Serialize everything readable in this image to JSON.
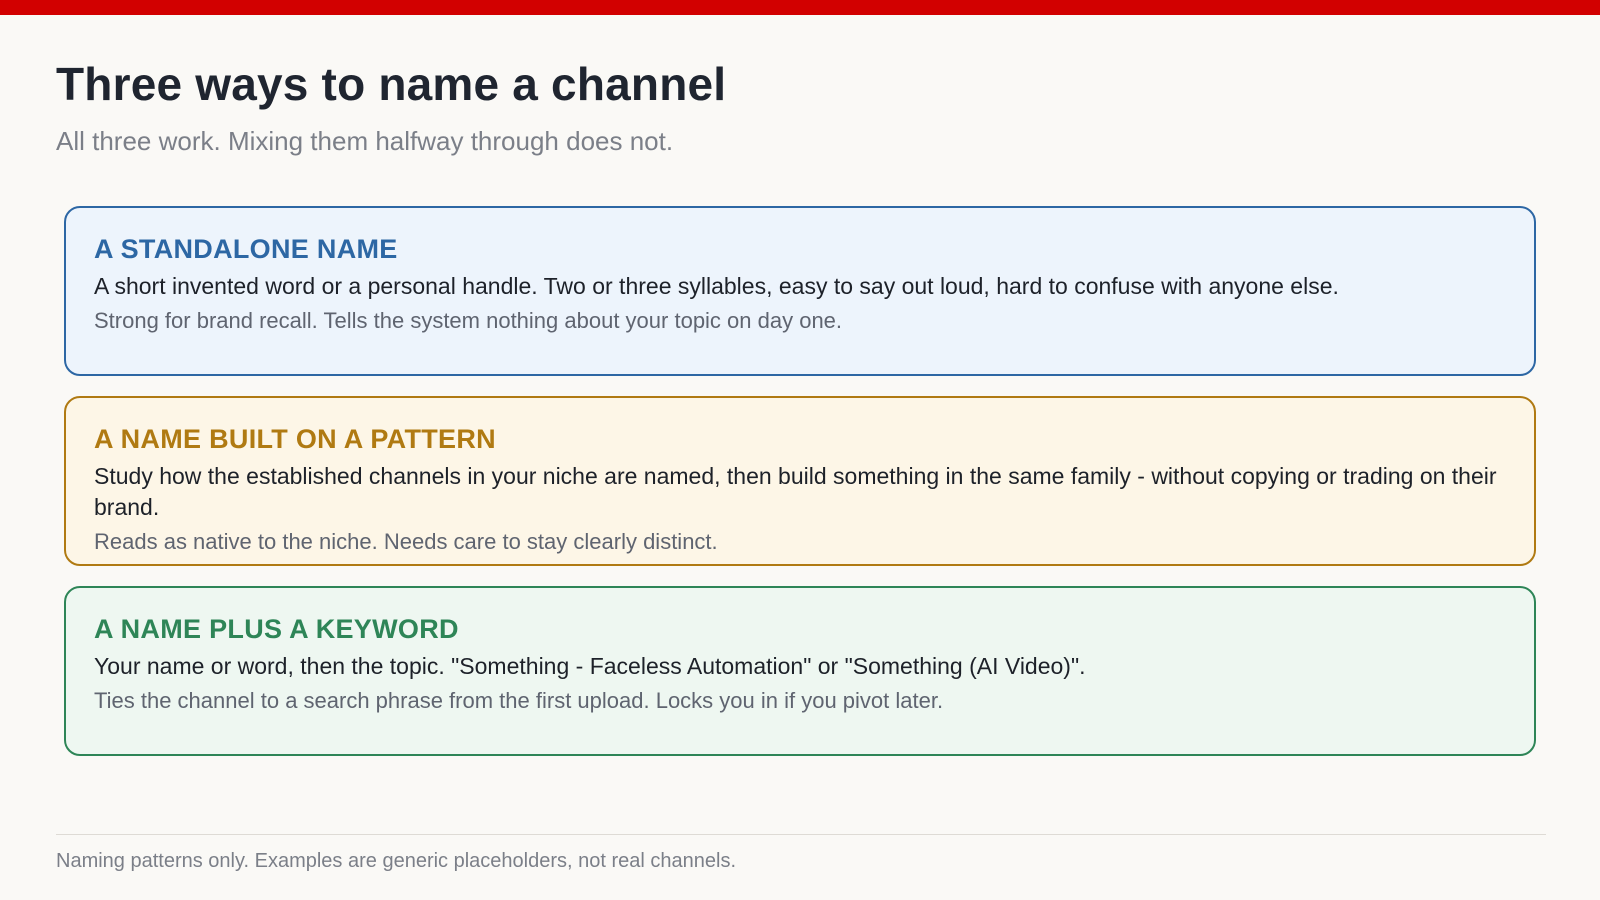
{
  "colors": {
    "top_bar": "#d20000",
    "blue": "#2d67a4",
    "blue_bg": "#edf4fc",
    "gold": "#b07a12",
    "gold_bg": "#fdf6e7",
    "green": "#2e8557",
    "green_bg": "#eef7f1"
  },
  "header": {
    "title": "Three ways to name a channel",
    "subtitle": "All three work. Mixing them halfway through does not."
  },
  "cards": [
    {
      "heading": "A STANDALONE NAME",
      "body": "A short invented word or a personal handle. Two or three syllables, easy to say out loud, hard to confuse with anyone else.",
      "note": "Strong for brand recall. Tells the system nothing about your topic on day one."
    },
    {
      "heading": "A NAME BUILT ON A PATTERN",
      "body": "Study how the established channels in your niche are named, then build something in the same family - without copying or trading on their brand.",
      "note": "Reads as native to the niche. Needs care to stay clearly distinct."
    },
    {
      "heading": "A NAME PLUS A KEYWORD",
      "body": "Your name or word, then the topic. \"Something - Faceless Automation\" or \"Something (AI Video)\".",
      "note": "Ties the channel to a search phrase from the first upload. Locks you in if you pivot later."
    }
  ],
  "footer": {
    "note": "Naming patterns only. Examples are generic placeholders, not real channels."
  }
}
